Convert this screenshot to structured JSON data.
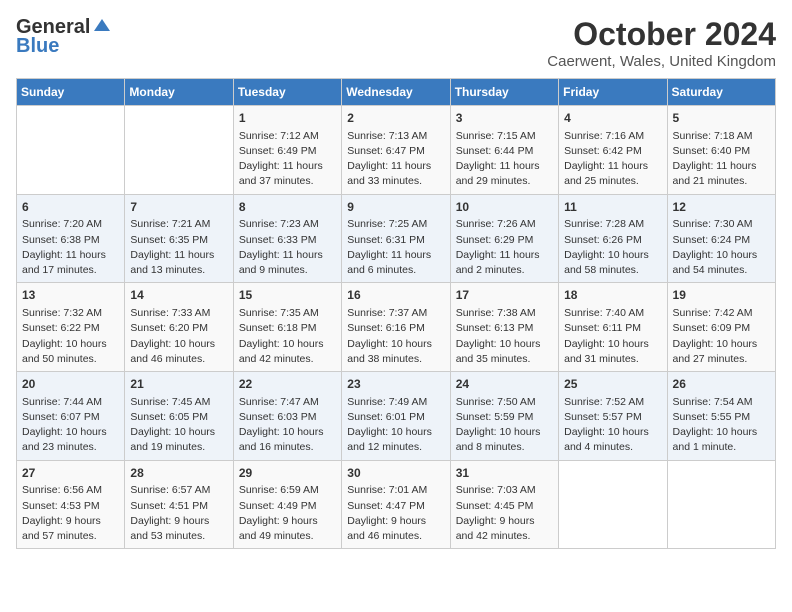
{
  "header": {
    "logo_general": "General",
    "logo_blue": "Blue",
    "month": "October 2024",
    "location": "Caerwent, Wales, United Kingdom"
  },
  "days_of_week": [
    "Sunday",
    "Monday",
    "Tuesday",
    "Wednesday",
    "Thursday",
    "Friday",
    "Saturday"
  ],
  "weeks": [
    [
      {
        "day": "",
        "info": ""
      },
      {
        "day": "",
        "info": ""
      },
      {
        "day": "1",
        "info": "Sunrise: 7:12 AM\nSunset: 6:49 PM\nDaylight: 11 hours and 37 minutes."
      },
      {
        "day": "2",
        "info": "Sunrise: 7:13 AM\nSunset: 6:47 PM\nDaylight: 11 hours and 33 minutes."
      },
      {
        "day": "3",
        "info": "Sunrise: 7:15 AM\nSunset: 6:44 PM\nDaylight: 11 hours and 29 minutes."
      },
      {
        "day": "4",
        "info": "Sunrise: 7:16 AM\nSunset: 6:42 PM\nDaylight: 11 hours and 25 minutes."
      },
      {
        "day": "5",
        "info": "Sunrise: 7:18 AM\nSunset: 6:40 PM\nDaylight: 11 hours and 21 minutes."
      }
    ],
    [
      {
        "day": "6",
        "info": "Sunrise: 7:20 AM\nSunset: 6:38 PM\nDaylight: 11 hours and 17 minutes."
      },
      {
        "day": "7",
        "info": "Sunrise: 7:21 AM\nSunset: 6:35 PM\nDaylight: 11 hours and 13 minutes."
      },
      {
        "day": "8",
        "info": "Sunrise: 7:23 AM\nSunset: 6:33 PM\nDaylight: 11 hours and 9 minutes."
      },
      {
        "day": "9",
        "info": "Sunrise: 7:25 AM\nSunset: 6:31 PM\nDaylight: 11 hours and 6 minutes."
      },
      {
        "day": "10",
        "info": "Sunrise: 7:26 AM\nSunset: 6:29 PM\nDaylight: 11 hours and 2 minutes."
      },
      {
        "day": "11",
        "info": "Sunrise: 7:28 AM\nSunset: 6:26 PM\nDaylight: 10 hours and 58 minutes."
      },
      {
        "day": "12",
        "info": "Sunrise: 7:30 AM\nSunset: 6:24 PM\nDaylight: 10 hours and 54 minutes."
      }
    ],
    [
      {
        "day": "13",
        "info": "Sunrise: 7:32 AM\nSunset: 6:22 PM\nDaylight: 10 hours and 50 minutes."
      },
      {
        "day": "14",
        "info": "Sunrise: 7:33 AM\nSunset: 6:20 PM\nDaylight: 10 hours and 46 minutes."
      },
      {
        "day": "15",
        "info": "Sunrise: 7:35 AM\nSunset: 6:18 PM\nDaylight: 10 hours and 42 minutes."
      },
      {
        "day": "16",
        "info": "Sunrise: 7:37 AM\nSunset: 6:16 PM\nDaylight: 10 hours and 38 minutes."
      },
      {
        "day": "17",
        "info": "Sunrise: 7:38 AM\nSunset: 6:13 PM\nDaylight: 10 hours and 35 minutes."
      },
      {
        "day": "18",
        "info": "Sunrise: 7:40 AM\nSunset: 6:11 PM\nDaylight: 10 hours and 31 minutes."
      },
      {
        "day": "19",
        "info": "Sunrise: 7:42 AM\nSunset: 6:09 PM\nDaylight: 10 hours and 27 minutes."
      }
    ],
    [
      {
        "day": "20",
        "info": "Sunrise: 7:44 AM\nSunset: 6:07 PM\nDaylight: 10 hours and 23 minutes."
      },
      {
        "day": "21",
        "info": "Sunrise: 7:45 AM\nSunset: 6:05 PM\nDaylight: 10 hours and 19 minutes."
      },
      {
        "day": "22",
        "info": "Sunrise: 7:47 AM\nSunset: 6:03 PM\nDaylight: 10 hours and 16 minutes."
      },
      {
        "day": "23",
        "info": "Sunrise: 7:49 AM\nSunset: 6:01 PM\nDaylight: 10 hours and 12 minutes."
      },
      {
        "day": "24",
        "info": "Sunrise: 7:50 AM\nSunset: 5:59 PM\nDaylight: 10 hours and 8 minutes."
      },
      {
        "day": "25",
        "info": "Sunrise: 7:52 AM\nSunset: 5:57 PM\nDaylight: 10 hours and 4 minutes."
      },
      {
        "day": "26",
        "info": "Sunrise: 7:54 AM\nSunset: 5:55 PM\nDaylight: 10 hours and 1 minute."
      }
    ],
    [
      {
        "day": "27",
        "info": "Sunrise: 6:56 AM\nSunset: 4:53 PM\nDaylight: 9 hours and 57 minutes."
      },
      {
        "day": "28",
        "info": "Sunrise: 6:57 AM\nSunset: 4:51 PM\nDaylight: 9 hours and 53 minutes."
      },
      {
        "day": "29",
        "info": "Sunrise: 6:59 AM\nSunset: 4:49 PM\nDaylight: 9 hours and 49 minutes."
      },
      {
        "day": "30",
        "info": "Sunrise: 7:01 AM\nSunset: 4:47 PM\nDaylight: 9 hours and 46 minutes."
      },
      {
        "day": "31",
        "info": "Sunrise: 7:03 AM\nSunset: 4:45 PM\nDaylight: 9 hours and 42 minutes."
      },
      {
        "day": "",
        "info": ""
      },
      {
        "day": "",
        "info": ""
      }
    ]
  ]
}
